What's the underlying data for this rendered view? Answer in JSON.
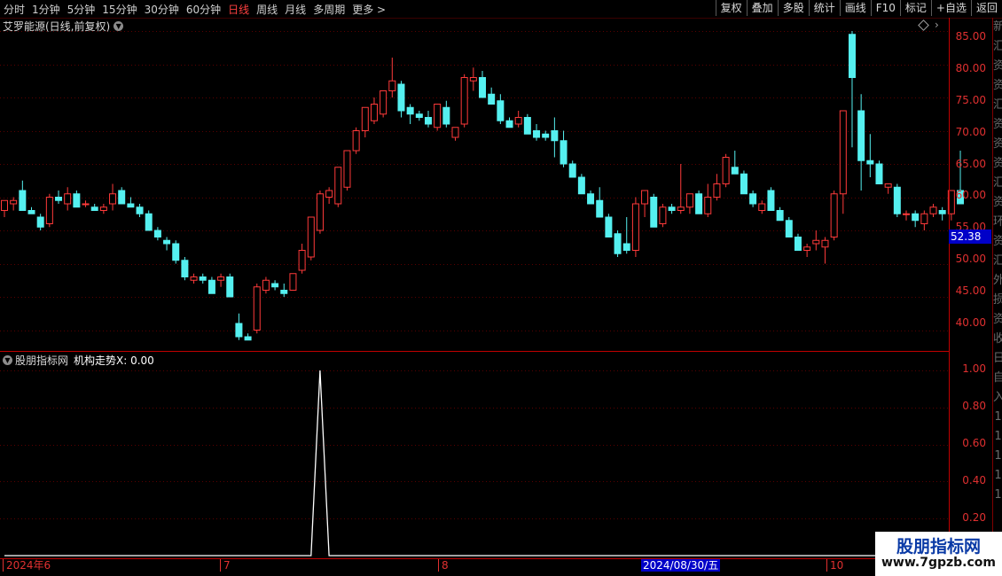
{
  "toolbar": {
    "periods": [
      "分时",
      "1分钟",
      "5分钟",
      "15分钟",
      "30分钟",
      "60分钟",
      "日线",
      "周线",
      "月线",
      "多周期",
      "更多 >"
    ],
    "actions": [
      "复权",
      "叠加",
      "多股",
      "统计",
      "画线",
      "F10",
      "标记",
      "+自选",
      "返回"
    ]
  },
  "chart": {
    "title": "艾罗能源(日线,前复权)",
    "price_ticks": [
      "85.00",
      "80.00",
      "75.00",
      "70.00",
      "65.00",
      "60.00",
      "55.00",
      "50.00",
      "45.00",
      "40.00"
    ],
    "current_price": "52.38"
  },
  "indicator": {
    "name": "股朋指标网",
    "label": "机构走势X: 0.00",
    "ticks": [
      "1.00",
      "0.80",
      "0.60",
      "0.40",
      "0.20"
    ]
  },
  "dates": {
    "labels": [
      "2024年6",
      "7",
      "8",
      "10"
    ],
    "selected": "2024/08/30/五"
  },
  "watermark": {
    "title": "股朋指标网",
    "url": "www.7gpzb.com"
  },
  "side_strip": [
    "新",
    "汇",
    "资",
    "资",
    "汇",
    "资",
    "资",
    "资",
    "汇",
    "资",
    "环",
    "资",
    "汇",
    "外",
    "损",
    "资",
    "收",
    "日",
    "自",
    "入",
    "1",
    "1",
    "1",
    "1",
    "1"
  ],
  "colors": {
    "up": "#ff3a3a",
    "down": "#55f0f0",
    "axis": "#c00000",
    "grid": "#5a0000"
  },
  "chart_data": {
    "type": "candlestick",
    "ylim": [
      37,
      87
    ],
    "candles": [
      [
        58,
        59.5,
        57,
        59.5
      ],
      [
        59,
        60,
        58,
        59.5
      ],
      [
        61,
        62.5,
        58,
        58
      ],
      [
        58,
        58.5,
        57.5,
        57.5
      ],
      [
        57,
        57.5,
        55,
        55.5
      ],
      [
        56,
        60.5,
        55.5,
        60
      ],
      [
        60,
        61,
        59,
        59.5
      ],
      [
        59,
        61.5,
        58,
        60.5
      ],
      [
        60.5,
        61,
        59,
        58.5
      ],
      [
        59,
        59.5,
        58.5,
        59
      ],
      [
        58.5,
        59,
        58,
        58
      ],
      [
        58,
        59,
        57.5,
        58.5
      ],
      [
        59,
        62,
        58,
        60.5
      ],
      [
        61,
        61.5,
        59.5,
        59
      ],
      [
        59,
        60,
        58.5,
        58.5
      ],
      [
        58.5,
        59,
        57,
        57.5
      ],
      [
        57.5,
        58,
        55,
        55
      ],
      [
        55,
        55.5,
        53.5,
        54
      ],
      [
        53.5,
        54,
        52,
        53
      ],
      [
        53,
        53.5,
        50,
        50.5
      ],
      [
        50.5,
        51,
        47.5,
        48
      ],
      [
        47.5,
        48.5,
        47,
        48
      ],
      [
        48,
        48.5,
        47,
        47.5
      ],
      [
        47.5,
        48,
        45.5,
        45.5
      ],
      [
        47.5,
        48.5,
        46.5,
        48
      ],
      [
        48,
        48.5,
        45,
        45
      ],
      [
        41,
        42.5,
        38.5,
        39
      ],
      [
        39,
        39.5,
        38.5,
        38.5
      ],
      [
        40,
        47,
        39.5,
        46.5
      ],
      [
        46,
        48,
        45.5,
        47.5
      ],
      [
        47,
        47.5,
        46,
        46.5
      ],
      [
        46,
        47,
        45,
        45.5
      ],
      [
        46,
        48.5,
        46,
        48.5
      ],
      [
        49,
        53,
        48.5,
        52
      ],
      [
        51,
        56.5,
        50.5,
        57
      ],
      [
        55,
        61,
        54.5,
        60.5
      ],
      [
        60,
        61.5,
        59,
        61
      ],
      [
        59,
        64.5,
        58.5,
        64.5
      ],
      [
        61.5,
        67,
        61,
        67
      ],
      [
        67,
        70.5,
        66.5,
        70
      ],
      [
        70,
        73.5,
        69,
        73.5
      ],
      [
        71.5,
        75,
        71,
        74
      ],
      [
        72.5,
        76,
        72,
        76
      ],
      [
        76,
        81,
        75,
        77.5
      ],
      [
        77,
        77.5,
        72,
        73
      ],
      [
        73.5,
        74,
        71,
        72.5
      ],
      [
        72.5,
        73,
        71.5,
        72
      ],
      [
        72,
        73,
        70.5,
        71
      ],
      [
        70.5,
        74,
        70,
        74
      ],
      [
        73.5,
        74.5,
        70.5,
        71
      ],
      [
        69,
        70,
        68.5,
        70.5
      ],
      [
        71,
        78.5,
        70.5,
        78
      ],
      [
        77.5,
        79.5,
        76,
        78
      ],
      [
        78,
        79,
        75,
        75
      ],
      [
        75.5,
        76.5,
        74,
        74
      ],
      [
        74.5,
        75.5,
        71,
        71.5
      ],
      [
        71.5,
        72,
        70.5,
        70.5
      ],
      [
        71,
        73,
        70.5,
        72
      ],
      [
        72,
        72.5,
        69.5,
        69.5
      ],
      [
        70,
        71,
        68.5,
        69
      ],
      [
        69.5,
        70,
        68.5,
        69
      ],
      [
        70,
        72,
        66,
        68.5
      ],
      [
        68.5,
        70,
        64.5,
        65
      ],
      [
        65,
        65.5,
        63,
        63
      ],
      [
        63,
        63.5,
        60.5,
        60.5
      ],
      [
        60.5,
        61,
        59,
        59
      ],
      [
        59.5,
        61.5,
        57,
        57
      ],
      [
        57,
        57.5,
        54,
        54
      ],
      [
        54.5,
        55,
        51,
        51.5
      ],
      [
        53,
        57,
        51.5,
        52
      ],
      [
        52,
        60,
        51,
        59
      ],
      [
        59,
        61,
        57,
        61
      ],
      [
        60,
        60.5,
        55.5,
        55.5
      ],
      [
        56,
        59,
        55.5,
        58.5
      ],
      [
        58.5,
        59,
        57.5,
        58
      ],
      [
        58,
        65,
        57.5,
        58.5
      ],
      [
        58.5,
        60.5,
        57.5,
        60.5
      ],
      [
        60.5,
        61,
        57.5,
        57.5
      ],
      [
        57.5,
        62,
        57,
        60
      ],
      [
        60,
        63.5,
        59.5,
        62
      ],
      [
        62,
        66.5,
        61.5,
        66
      ],
      [
        64.5,
        67,
        63.5,
        63.5
      ],
      [
        63.5,
        64,
        60.5,
        60.5
      ],
      [
        60.5,
        61,
        58.5,
        59
      ],
      [
        58,
        59.5,
        57.5,
        59
      ],
      [
        61,
        61.5,
        58,
        58
      ],
      [
        58,
        58.5,
        56.5,
        56.5
      ],
      [
        56.5,
        57,
        54,
        54
      ],
      [
        54,
        54.5,
        52,
        52
      ],
      [
        52,
        53,
        51,
        52.5
      ],
      [
        53,
        55,
        52,
        53.5
      ],
      [
        52.5,
        54,
        50,
        53.5
      ],
      [
        54,
        61,
        53.5,
        60.5
      ],
      [
        60.5,
        73,
        57.5,
        73
      ],
      [
        84.5,
        85,
        67.5,
        78
      ],
      [
        73,
        75.5,
        61,
        65.5
      ],
      [
        65.5,
        69.5,
        63,
        65
      ],
      [
        65,
        65.5,
        62,
        62
      ],
      [
        61.5,
        62,
        60.5,
        62
      ],
      [
        61.5,
        62,
        57,
        57.5
      ],
      [
        57.5,
        58,
        56.5,
        57.5
      ],
      [
        57.5,
        58,
        55.5,
        56.5
      ],
      [
        56,
        58,
        55,
        57.5
      ],
      [
        57.5,
        59,
        57,
        58.5
      ],
      [
        58,
        58.5,
        56.5,
        57.5
      ],
      [
        57.5,
        61,
        56.5,
        61
      ],
      [
        61,
        67,
        59.5,
        59
      ]
    ]
  }
}
